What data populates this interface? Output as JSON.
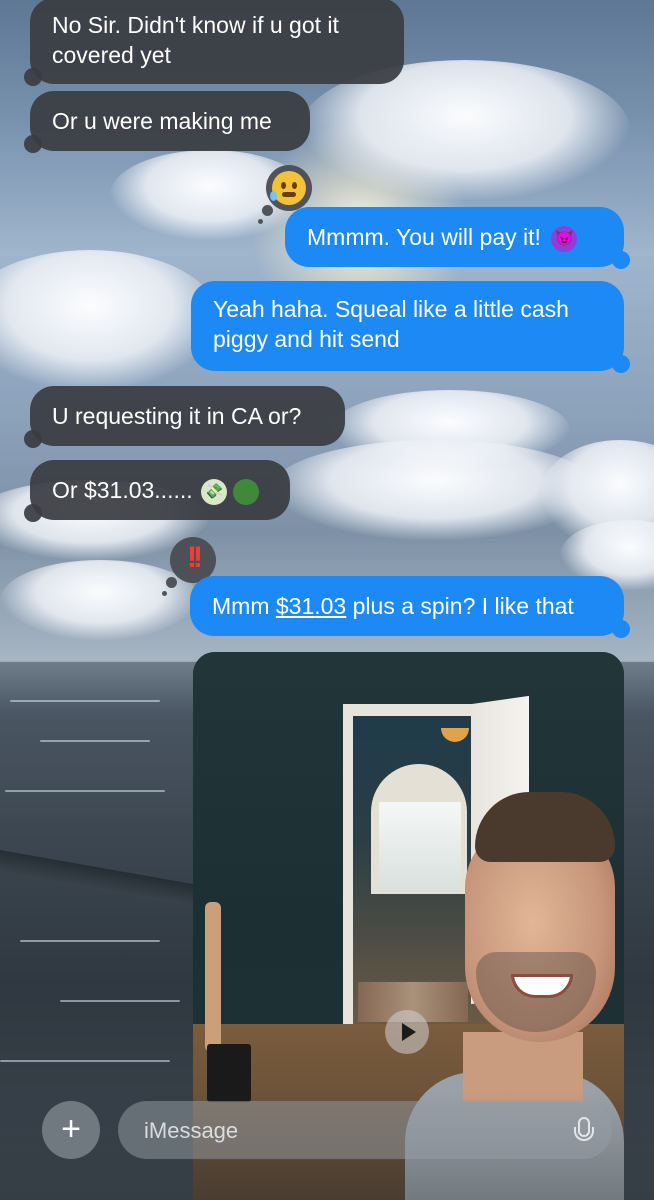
{
  "messages": [
    {
      "direction": "received",
      "text": "No Sir.  Didn't know if u got it covered yet"
    },
    {
      "direction": "received",
      "text": "Or u were making me"
    },
    {
      "direction": "sent",
      "text": "Mmmm. You will pay it!",
      "emoji": "smiling-devil-emoji",
      "tapback": "anxious-sweat-face"
    },
    {
      "direction": "sent",
      "text": "Yeah haha. Squeal like a little cash piggy and hit send"
    },
    {
      "direction": "received",
      "text": "U requesting it in CA or?"
    },
    {
      "direction": "received",
      "text": "Or $31.03......",
      "emojis": [
        "money-with-wings-emoji",
        "green-dollar-circle-emoji"
      ]
    },
    {
      "direction": "sent",
      "text_before": "Mmm ",
      "link": "$31.03",
      "text_after": " plus a spin? I like that",
      "tapback": "double-exclamation"
    },
    {
      "direction": "sent",
      "type": "video",
      "has_play_button": true
    }
  ],
  "composer": {
    "placeholder": "iMessage",
    "plus_label": "+",
    "mic_icon": "microphone-icon"
  },
  "colors": {
    "sent_bubble": "#1c89f5",
    "received_bubble": "#3a3c42",
    "tapback_red": "#ff3b30"
  }
}
